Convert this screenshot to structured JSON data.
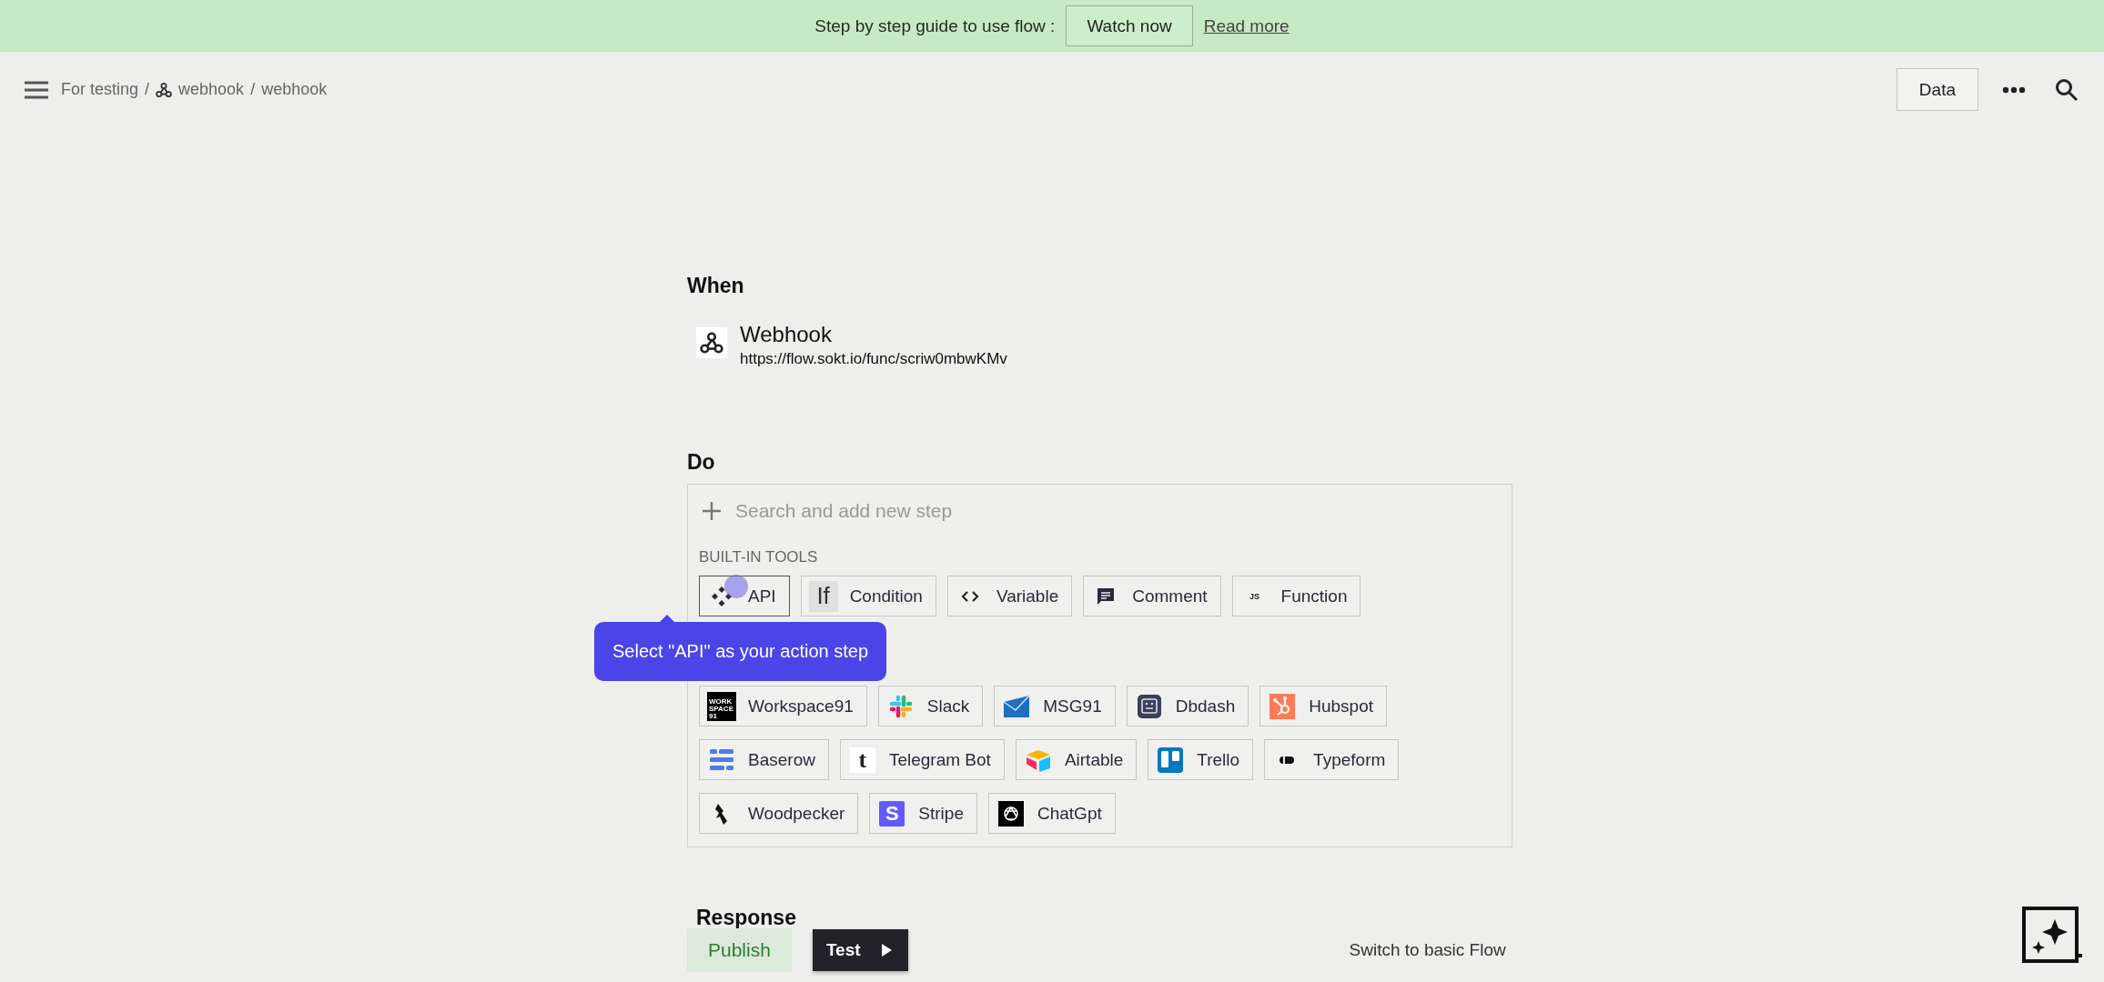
{
  "banner": {
    "text": "Step by step guide to use flow :",
    "watch_button": "Watch now",
    "read_link": "Read more"
  },
  "header": {
    "breadcrumb": [
      {
        "kind": "text",
        "label": "For testing"
      },
      {
        "kind": "separator",
        "label": "/"
      },
      {
        "kind": "icon-link",
        "label": "webhook"
      },
      {
        "kind": "separator",
        "label": "/"
      },
      {
        "kind": "text",
        "label": "webhook"
      }
    ],
    "data_button": "Data"
  },
  "when": {
    "heading": "When",
    "trigger": {
      "title": "Webhook",
      "url": "https://flow.sokt.io/func/scriw0mbwKMv"
    }
  },
  "do": {
    "heading": "Do",
    "search": {
      "placeholder": "Search and add new step"
    },
    "built_in": {
      "heading": "BUILT-IN TOOLS",
      "tools": [
        {
          "label": "API"
        },
        {
          "label": "Condition",
          "badge": "If"
        },
        {
          "label": "Variable"
        },
        {
          "label": "Comment"
        },
        {
          "label": "Function",
          "badge": "JS"
        }
      ]
    },
    "integrations": [
      [
        {
          "label": "Workspace91",
          "badge": "WORK SPACE 91"
        },
        {
          "label": "Slack"
        },
        {
          "label": "MSG91"
        },
        {
          "label": "Dbdash"
        },
        {
          "label": "Hubspot"
        }
      ],
      [
        {
          "label": "Baserow"
        },
        {
          "label": "Telegram Bot",
          "badge": "t"
        },
        {
          "label": "Airtable"
        },
        {
          "label": "Trello"
        },
        {
          "label": "Typeform"
        }
      ],
      [
        {
          "label": "Woodpecker"
        },
        {
          "label": "Stripe",
          "badge": "S"
        },
        {
          "label": "ChatGpt"
        }
      ]
    ]
  },
  "tooltip": {
    "text": "Select \"API\" as your action step"
  },
  "response": {
    "heading": "Response"
  },
  "actions": {
    "publish": "Publish",
    "test": "Test",
    "switch_link": "Switch to basic Flow"
  }
}
